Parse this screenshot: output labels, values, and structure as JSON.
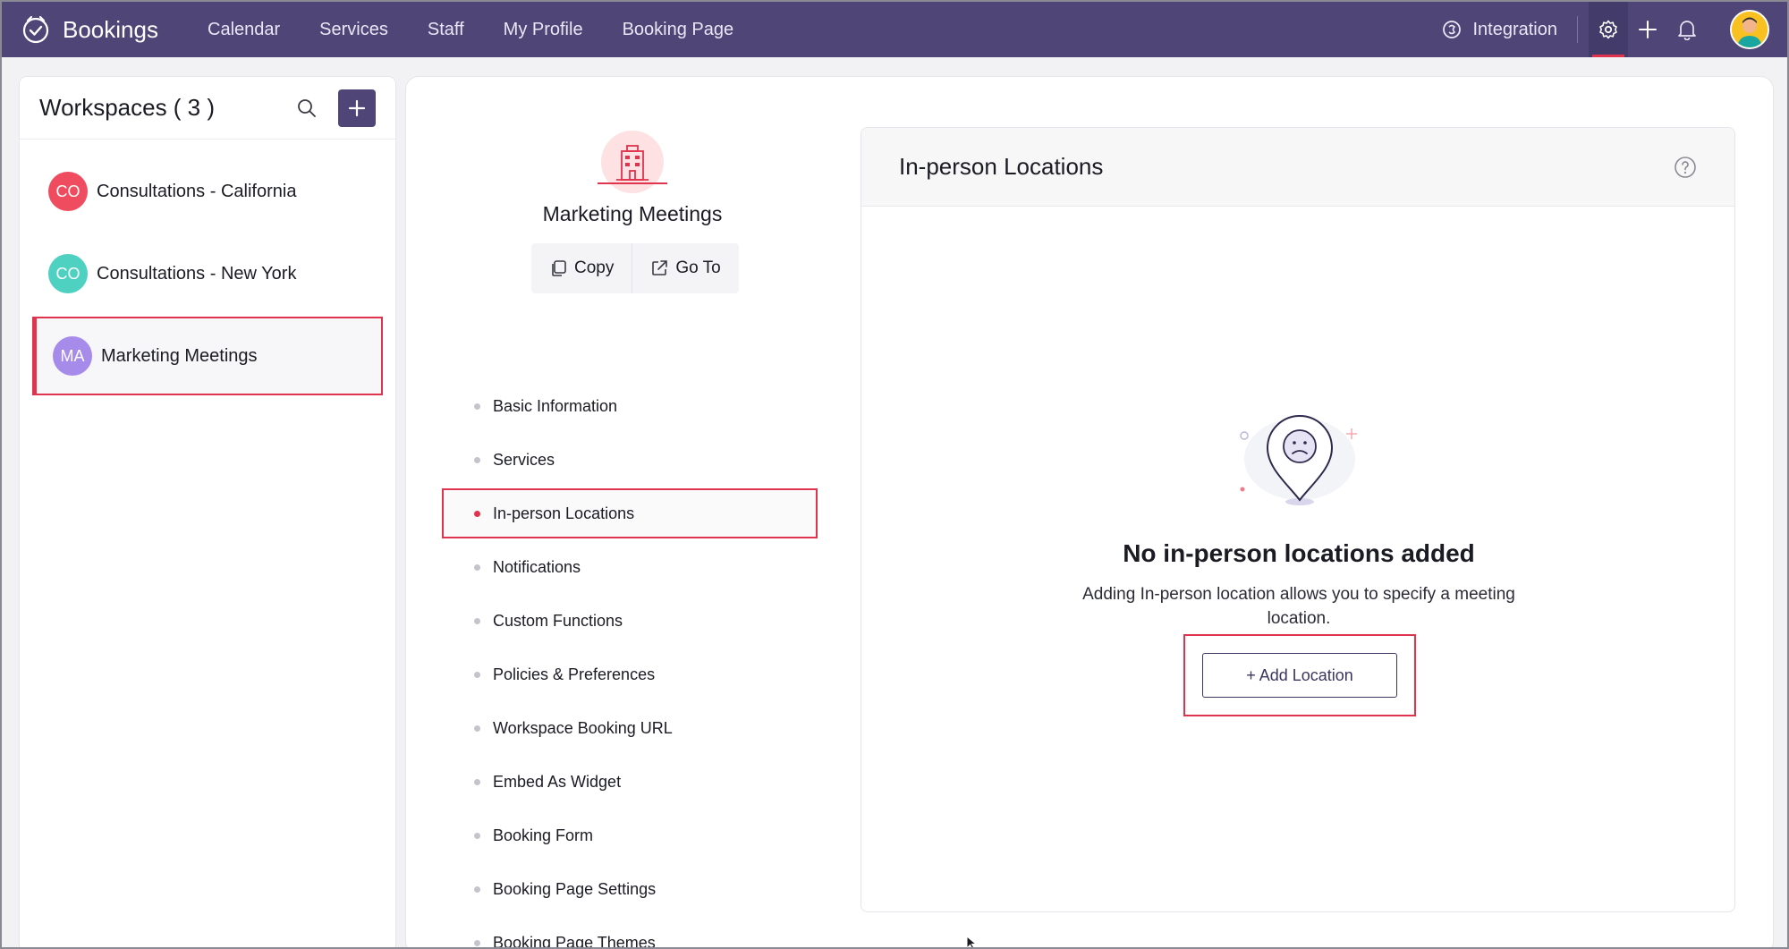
{
  "app": {
    "name": "Bookings"
  },
  "nav": {
    "items": [
      "Calendar",
      "Services",
      "Staff",
      "My Profile",
      "Booking Page"
    ]
  },
  "topbar": {
    "integration_label": "Integration",
    "icons": [
      "integration-icon",
      "settings-icon",
      "plus-icon",
      "bell-icon",
      "avatar"
    ]
  },
  "workspaces": {
    "title": "Workspaces ( 3 )",
    "items": [
      {
        "initials": "CO",
        "name": "Consultations - California",
        "color": "#ef4d5f"
      },
      {
        "initials": "CO",
        "name": "Consultations - New York",
        "color": "#4fd1c1"
      },
      {
        "initials": "MA",
        "name": "Marketing Meetings",
        "color": "#a78bea"
      }
    ],
    "selected_index": 2
  },
  "workspace_detail": {
    "title": "Marketing Meetings",
    "copy_label": "Copy",
    "goto_label": "Go To",
    "menu": [
      "Basic Information",
      "Services",
      "In-person Locations",
      "Notifications",
      "Custom Functions",
      "Policies & Preferences",
      "Workspace Booking URL",
      "Embed As Widget",
      "Booking Form",
      "Booking Page Settings",
      "Booking Page Themes"
    ],
    "selected_menu_index": 2
  },
  "content": {
    "title": "In-person Locations",
    "empty_title": "No in-person locations added",
    "empty_description": "Adding In-person location allows you to specify a meeting location.",
    "add_button_label": "+ Add Location"
  },
  "colors": {
    "topbar": "#4f4677",
    "accent": "#e0334e",
    "primary_button": "#4f4677"
  }
}
